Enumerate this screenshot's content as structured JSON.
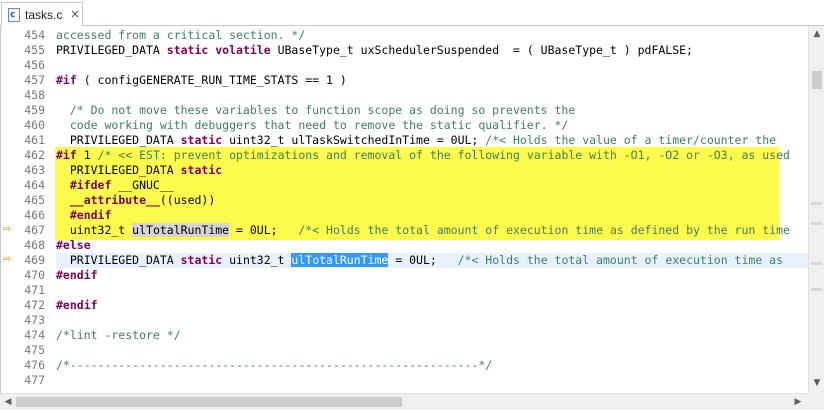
{
  "tab": {
    "label": "tasks.c",
    "icon": "c-source-file-icon",
    "close_glyph": "✕",
    "file_badge": "c"
  },
  "colors": {
    "highlight_block": "#fdfb4c",
    "current_line": "#e8f2fe",
    "keyword": "#7f0055",
    "comment": "#3f7f5f",
    "selection": "#3399ff"
  },
  "lines": [
    {
      "no": "454",
      "segments": [
        {
          "t": "accessed from a critical section. */",
          "c": "cm"
        }
      ]
    },
    {
      "no": "455",
      "segments": [
        {
          "t": "PRIVILEGED_DATA ",
          "c": ""
        },
        {
          "t": "static volatile",
          "c": "kw"
        },
        {
          "t": " UBaseType_t uxSchedulerSuspended  = ( UBaseType_t ) pdFALSE;",
          "c": ""
        }
      ]
    },
    {
      "no": "456",
      "segments": []
    },
    {
      "no": "457",
      "segments": [
        {
          "t": "#if",
          "c": "pp"
        },
        {
          "t": " ( configGENERATE_RUN_TIME_STATS == 1 )",
          "c": ""
        }
      ]
    },
    {
      "no": "458",
      "segments": []
    },
    {
      "no": "459",
      "segments": [
        {
          "t": "  /* Do not move these variables to function scope as doing so prevents the",
          "c": "cm"
        }
      ]
    },
    {
      "no": "460",
      "segments": [
        {
          "t": "  code working with debuggers that need to remove the static qualifier. */",
          "c": "cm"
        }
      ]
    },
    {
      "no": "461",
      "segments": [
        {
          "t": "  PRIVILEGED_DATA ",
          "c": ""
        },
        {
          "t": "static",
          "c": "kw"
        },
        {
          "t": " uint32_t ulTaskSwitchedInTime = 0UL; ",
          "c": ""
        },
        {
          "t": "/*< Holds the value of a timer/counter the",
          "c": "cm"
        }
      ]
    },
    {
      "no": "462",
      "segments": [
        {
          "t": "#if",
          "c": "pp"
        },
        {
          "t": " 1 ",
          "c": ""
        },
        {
          "t": "/* << EST: prevent optimizations and removal of the following variable with -O1, -O2 or -O3, as used",
          "c": "cm"
        }
      ]
    },
    {
      "no": "463",
      "segments": [
        {
          "t": "  PRIVILEGED_DATA ",
          "c": ""
        },
        {
          "t": "static",
          "c": "kw"
        }
      ]
    },
    {
      "no": "464",
      "segments": [
        {
          "t": "  #ifdef",
          "c": "pp"
        },
        {
          "t": " __GNUC__",
          "c": ""
        }
      ]
    },
    {
      "no": "465",
      "segments": [
        {
          "t": "  ",
          "c": ""
        },
        {
          "t": "__attribute__",
          "c": "kw"
        },
        {
          "t": "((used))",
          "c": ""
        }
      ]
    },
    {
      "no": "466",
      "segments": [
        {
          "t": "  #endif",
          "c": "pp"
        }
      ]
    },
    {
      "no": "467",
      "segments": [
        {
          "t": "  uint32_t ",
          "c": ""
        },
        {
          "t": "ulTotalRunTime",
          "c": "occ"
        },
        {
          "t": " = 0UL;   ",
          "c": ""
        },
        {
          "t": "/*< Holds the total amount of execution time as defined by the run time",
          "c": "cm"
        }
      ]
    },
    {
      "no": "468",
      "segments": [
        {
          "t": "#else",
          "c": "pp"
        }
      ]
    },
    {
      "no": "469",
      "segments": [
        {
          "t": "  PRIVILEGED_DATA ",
          "c": ""
        },
        {
          "t": "static",
          "c": "kw"
        },
        {
          "t": " uint32_t ",
          "c": ""
        },
        {
          "t": "ulTotalRunTime",
          "c": "sel"
        },
        {
          "t": " = 0UL;   ",
          "c": ""
        },
        {
          "t": "/*< Holds the total amount of execution time as",
          "c": "cm"
        }
      ]
    },
    {
      "no": "470",
      "segments": [
        {
          "t": "#endif",
          "c": "pp"
        }
      ]
    },
    {
      "no": "471",
      "segments": []
    },
    {
      "no": "472",
      "segments": [
        {
          "t": "#endif",
          "c": "pp"
        }
      ]
    },
    {
      "no": "473",
      "segments": []
    },
    {
      "no": "474",
      "segments": [
        {
          "t": "/*lint -restore */",
          "c": "cm"
        }
      ]
    },
    {
      "no": "475",
      "segments": []
    },
    {
      "no": "476",
      "segments": [
        {
          "t": "/*-----------------------------------------------------------*/",
          "c": "cm"
        }
      ]
    },
    {
      "no": "477",
      "segments": []
    }
  ],
  "marker_lines": [
    "467",
    "469"
  ],
  "current_line": "469",
  "scrollbars": {
    "up": "▲",
    "down": "▼",
    "left": "◀",
    "right": "▶"
  }
}
